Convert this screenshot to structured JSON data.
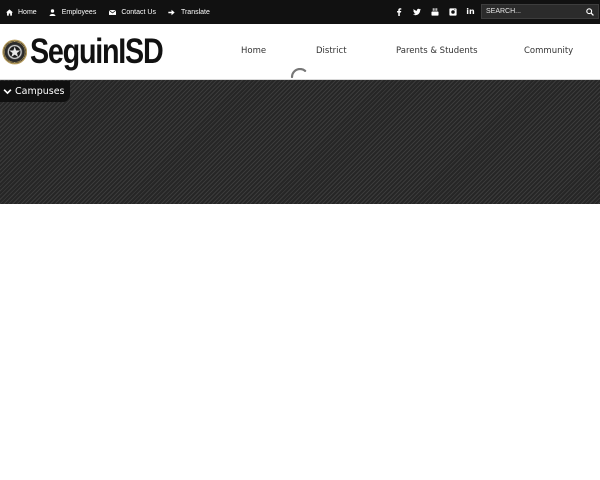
{
  "utility_links": [
    {
      "label": "Home",
      "icon": "home-icon"
    },
    {
      "label": "Employees",
      "icon": "user-icon"
    },
    {
      "label": "Contact Us",
      "icon": "envelope-icon"
    },
    {
      "label": "Translate",
      "icon": "arrow-right-icon"
    }
  ],
  "social": [
    {
      "icon": "facebook-icon"
    },
    {
      "icon": "twitter-icon"
    },
    {
      "icon": "youtube-icon"
    },
    {
      "icon": "instagram-icon"
    },
    {
      "icon": "linkedin-icon",
      "text": "in"
    }
  ],
  "search": {
    "placeholder": "SEARCH...",
    "value": ""
  },
  "logo": {
    "text": "SeguinISD"
  },
  "nav": [
    {
      "label": "Home"
    },
    {
      "label": "District"
    },
    {
      "label": "Parents & Students"
    },
    {
      "label": "Community"
    }
  ],
  "campuses": {
    "label": "Campuses"
  },
  "colors": {
    "topbar_bg": "#111111",
    "banner_bg": "#2e2e2e",
    "seal_gold": "#b59a5a",
    "nav_text": "#333333"
  }
}
